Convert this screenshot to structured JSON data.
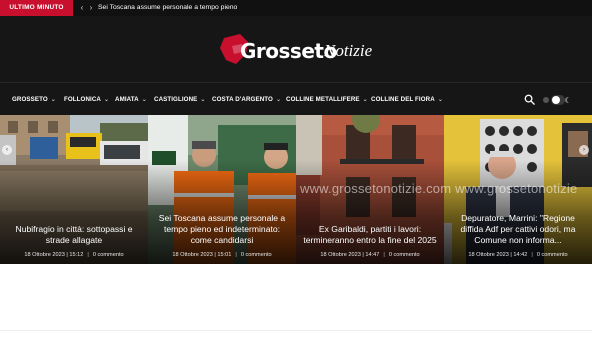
{
  "ticker": {
    "badge": "ULTIMO MINUTO",
    "prev_icon": "chevron-left-icon",
    "next_icon": "chevron-right-icon",
    "headline": "Sei Toscana assume personale a tempo pieno"
  },
  "logo": {
    "word1": "Grosseto",
    "word2": "Notizie",
    "accent": "#c8102e"
  },
  "nav": {
    "items": [
      {
        "label": "GROSSETO"
      },
      {
        "label": "FOLLONICA"
      },
      {
        "label": "AMIATA"
      },
      {
        "label": "CASTIGLIONE"
      },
      {
        "label": "COSTA D'ARGENTO"
      },
      {
        "label": "COLLINE METALLIFERE"
      },
      {
        "label": "COLLINE DEL FIORA"
      }
    ],
    "search_icon": "search-icon",
    "theme_toggle_icons": [
      "sun-icon",
      "moon-icon"
    ]
  },
  "slider": {
    "watermark": "www.grossetonotizie.com www.grossetonotizie",
    "cards": [
      {
        "title": "Nubifragio in città: sottopassi e strade allagate",
        "date": "18 Ottobre 2023 | 15:12",
        "comments": "0 commento"
      },
      {
        "title": "Sei Toscana assume personale a tempo pieno ed indeterminato: come candidarsi",
        "date": "18 Ottobre 2023 | 15:01",
        "comments": "0 commento"
      },
      {
        "title": "Ex Garibaldi, partiti i lavori: termineranno entro la fine del 2025",
        "date": "18 Ottobre 2023 | 14:47",
        "comments": "0 commento"
      },
      {
        "title": "Depuratore, Marrini: \"Regione diffida Adf per cattivi odori, ma Comune non informa...",
        "date": "18 Ottobre 2023 | 14:42",
        "comments": "0 commento"
      }
    ]
  }
}
